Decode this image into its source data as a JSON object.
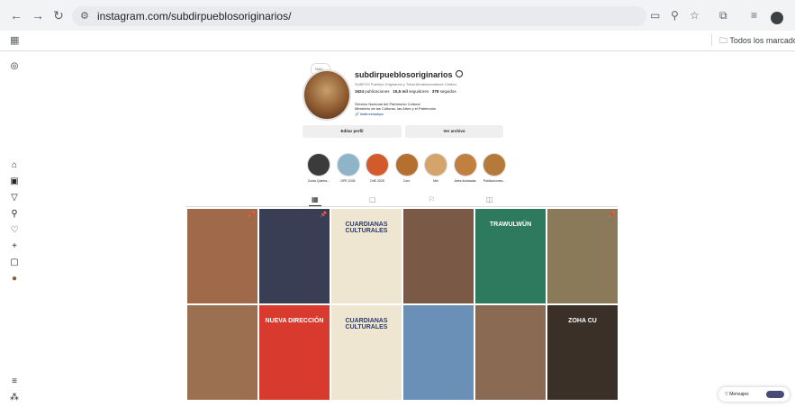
{
  "browser": {
    "url": "instagram.com/subdirpueblosoriginarios/",
    "bookmark_folder": "Todos los marcadores"
  },
  "profile": {
    "username": "subdirpueblosoriginarios",
    "note": "Nota...",
    "full_name": "SUBPOS Pueblos Originarios y Tribal Afrodescendiente Chileno",
    "posts": "1624",
    "posts_label": "publicaciones",
    "followers": "15,5 mil",
    "followers_label": "seguidores",
    "following": "378",
    "following_label": "seguidos",
    "bio_line1": "Servicio Nacional del Patrimonio Cultural",
    "bio_line2": "Ministerio de las Culturas, las Artes y el Patrimonio",
    "link": "linktr.ee/subpo",
    "edit_button": "Editar perfil",
    "archive_button": "Ver archivo"
  },
  "highlights": [
    {
      "label": "Cuida Quintra...",
      "color": "#3b3b3b"
    },
    {
      "label": "DPE 2026",
      "color": "#8fb4c9"
    },
    {
      "label": "DdS 2025",
      "color": "#d35a2a"
    },
    {
      "label": "Coro",
      "color": "#b5702f"
    },
    {
      "label": "Mel",
      "color": "#d4a46a"
    },
    {
      "label": "Artes ilustradas",
      "color": "#c28040"
    },
    {
      "label": "Publicaciones...",
      "color": "#b57a3a"
    }
  ],
  "posts_grid": {
    "row1": [
      {
        "label": "",
        "color": "#a06a4a"
      },
      {
        "label": "",
        "color": "#3a3e55"
      },
      {
        "label": "CUARDIANAS CULTURALES",
        "color": "#efe6d2"
      },
      {
        "label": "",
        "color": "#7a5a46"
      },
      {
        "label": "TRAWULWÜN",
        "color": "#2d7a5e"
      },
      {
        "label": "",
        "color": "#8a7a5a"
      }
    ],
    "row2": [
      {
        "label": "",
        "color": "#9a7050"
      },
      {
        "label": "NUEVA DIRECCIÓN",
        "color": "#d83a2e"
      },
      {
        "label": "CUARDIANAS CULTURALES",
        "color": "#efe6d2"
      },
      {
        "label": "",
        "color": "#6a90b8"
      },
      {
        "label": "",
        "color": "#8a6a52"
      },
      {
        "label": "ZOHA CU",
        "color": "#3a3028"
      }
    ]
  },
  "messages": {
    "label": "Mensajes"
  }
}
